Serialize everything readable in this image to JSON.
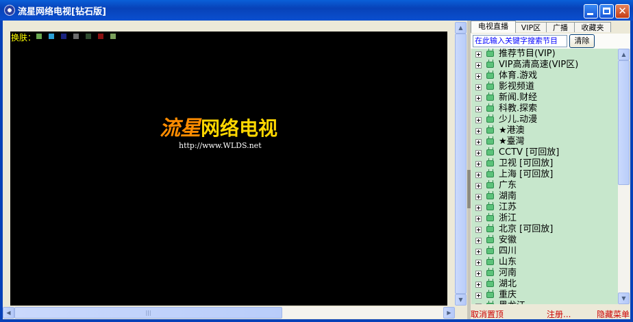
{
  "window": {
    "title": "流星网络电视[钻石版]",
    "min_glyph": "",
    "max_glyph": "",
    "close_glyph": "✕"
  },
  "player": {
    "skin_label": "换肤：",
    "skin_colors": [
      "#6aa84f",
      "#2a9fd6",
      "#1a237e",
      "#6d6d6d",
      "#2e4a2e",
      "#8b1010",
      "#7ba05b"
    ],
    "logo_part1": "流星",
    "logo_part2": "网络电视",
    "url": "http://www.WLDS.net"
  },
  "tabs": [
    {
      "label": "电视直播",
      "active": true
    },
    {
      "label": "VIP区",
      "active": false
    },
    {
      "label": "广播",
      "active": false
    },
    {
      "label": "收藏夹",
      "active": false
    }
  ],
  "search": {
    "placeholder": "在此输入关键字搜索节目",
    "clear_label": "清除"
  },
  "channels": [
    "推荐节目(VIP)",
    "VIP高清高速(VIP区)",
    "体育.游戏",
    "影视频道",
    "新闻.财经",
    "科教.探索",
    "少儿.动漫",
    "★港澳",
    "★臺灣",
    "CCTV [可回放]",
    "卫视 [可回放]",
    "上海 [可回放]",
    "广东",
    "湖南",
    "江苏",
    "浙江",
    "北京 [可回放]",
    "安徽",
    "四川",
    "山东",
    "河南",
    "湖北",
    "重庆",
    "黑龙江"
  ],
  "status": {
    "unpin": "取消置顶",
    "register": "注册...",
    "hide_menu": "隐藏菜单"
  },
  "scroll_glyphs": {
    "up": "▲",
    "down": "▼",
    "left": "◀",
    "right": "▶",
    "grip": "|||"
  }
}
